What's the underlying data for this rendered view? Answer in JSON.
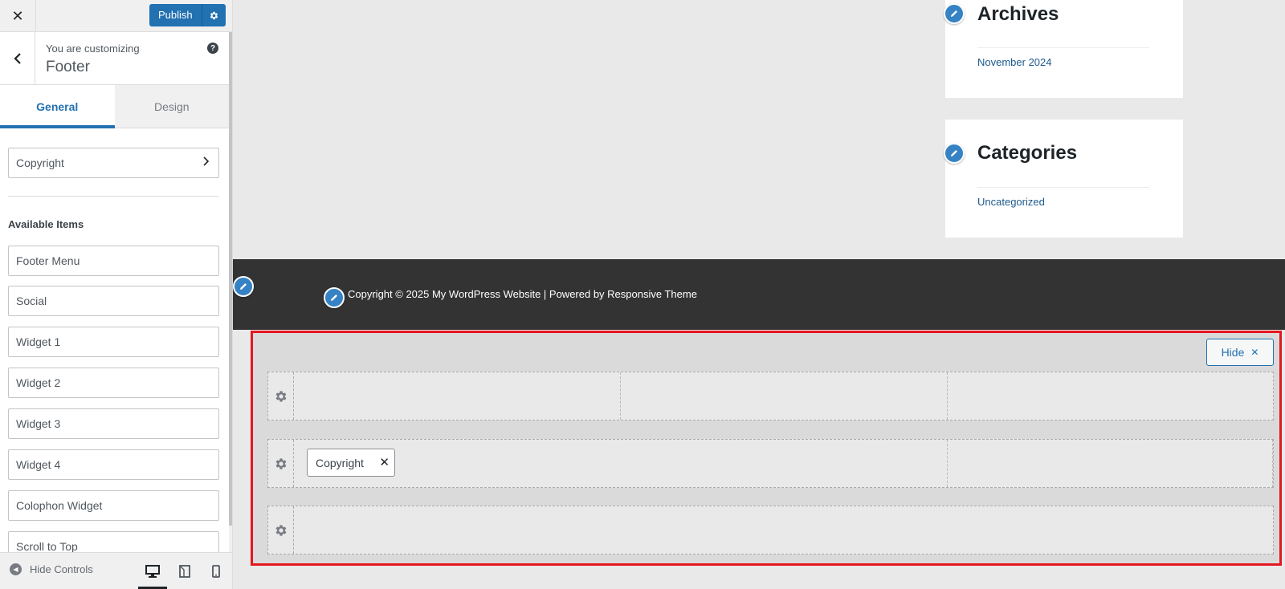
{
  "topbar": {
    "close_glyph": "✕",
    "publish_label": "Publish",
    "publish_settings_icon": "gear-icon"
  },
  "section_header": {
    "customizing_label": "You are customizing",
    "title": "Footer",
    "back_icon": "chevron-left-icon",
    "help_glyph": "?"
  },
  "tabs": [
    {
      "label": "General",
      "active": true
    },
    {
      "label": "Design",
      "active": false
    }
  ],
  "panel": {
    "copyright_setting_label": "Copyright",
    "available_items_label": "Available Items",
    "available_items": [
      "Footer Menu",
      "Social",
      "Widget 1",
      "Widget 2",
      "Widget 3",
      "Widget 4",
      "Colophon Widget",
      "Scroll to Top"
    ]
  },
  "footer_controls": {
    "hide_controls_label": "Hide Controls",
    "devices": [
      "desktop-icon",
      "tablet-icon",
      "mobile-icon"
    ],
    "active_device": "desktop"
  },
  "preview": {
    "widgets": [
      {
        "title": "Archives",
        "links": [
          "November 2024"
        ]
      },
      {
        "title": "Categories",
        "links": [
          "Uncategorized"
        ]
      }
    ],
    "site_footer": {
      "text_prefix": "Copyright © 2025 My WordPress Website | Powered by ",
      "theme_link": "Responsive Theme"
    }
  },
  "builder": {
    "hide_label": "Hide",
    "hide_glyph": "✕",
    "rows": [
      {
        "name": "above",
        "columns": 3,
        "items": []
      },
      {
        "name": "primary",
        "columns": 2,
        "items": [
          "Copyright"
        ]
      },
      {
        "name": "below",
        "columns": 1,
        "items": []
      }
    ],
    "chip_close_glyph": "✕"
  },
  "colors": {
    "accent": "#2271b1",
    "footer_bg": "#333333",
    "highlight_border": "#e4161f",
    "edit_icon": "#3582c4"
  }
}
